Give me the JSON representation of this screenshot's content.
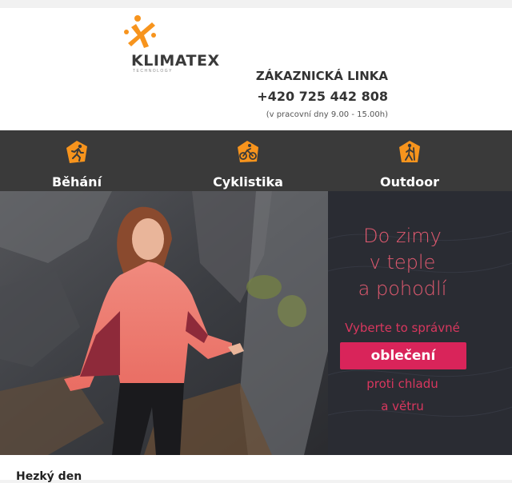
{
  "brand": {
    "name": "KLIMATEX",
    "tagline": "TECHNOLOGY",
    "logo_color": "#f7941d"
  },
  "contact": {
    "title": "ZÁKAZNICKÁ LINKA",
    "phone": "+420 725 442 808",
    "hours": "(v pracovní dny 9.00 - 15.00h)"
  },
  "nav": {
    "items": [
      {
        "label": "Běhání",
        "icon": "running-icon"
      },
      {
        "label": "Cyklistika",
        "icon": "cycling-icon"
      },
      {
        "label": "Outdoor",
        "icon": "hiking-icon"
      }
    ],
    "icon_color": "#f7941d"
  },
  "hero": {
    "headline_lines": [
      "Do zimy",
      "v teple",
      "a pohodlí"
    ],
    "pre_cta": "Vyberte to správné",
    "cta": "oblečení",
    "post_cta_lines": [
      "proti chladu",
      "a větru"
    ],
    "accent": "#d9245a"
  },
  "body": {
    "greeting": "Hezký den"
  }
}
